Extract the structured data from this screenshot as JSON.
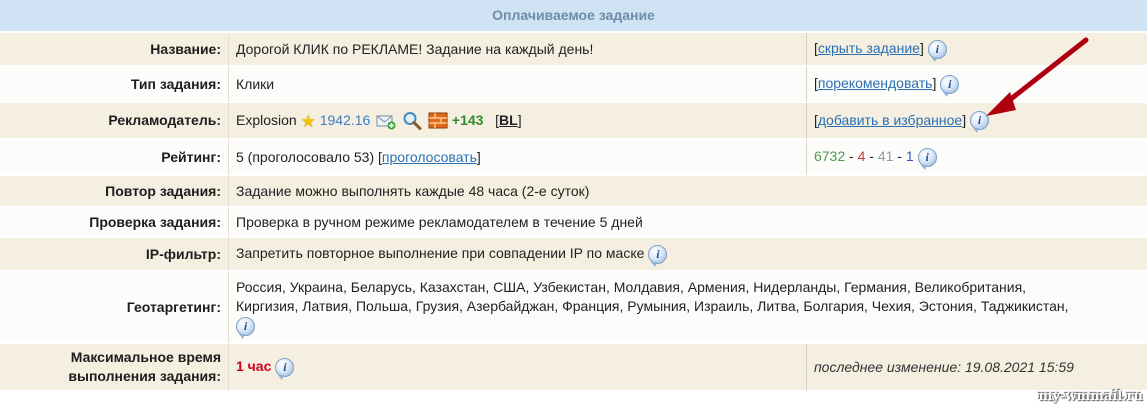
{
  "header": {
    "title": "Оплачиваемое задание"
  },
  "rows": {
    "name": {
      "label": "Название:",
      "value": "Дорогой КЛИК по РЕКЛАМЕ! Задание на каждый день!",
      "action": "скрыть задание"
    },
    "type": {
      "label": "Тип задания:",
      "value": "Клики",
      "action": "порекомендовать"
    },
    "advertiser": {
      "label": "Рекламодатель:",
      "name": "Explosion",
      "rating": "1942.16",
      "score": "+143",
      "bl": "BL",
      "action": "добавить в избранное"
    },
    "rating": {
      "label": "Рейтинг:",
      "value": "5 (проголосовало 53)",
      "vote_link": "проголосовать",
      "votes": {
        "green": "6732",
        "red": "4",
        "gray": "41",
        "blue": "1"
      }
    },
    "repeat": {
      "label": "Повтор задания:",
      "value": "Задание можно выполнять каждые 48 часа (2-е суток)"
    },
    "check": {
      "label": "Проверка задания:",
      "value": "Проверка в ручном режиме рекламодателем в течение 5 дней"
    },
    "ipfilter": {
      "label": "IP-фильтр:",
      "value": "Запретить повторное выполнение при совпадении IP по маске"
    },
    "geo": {
      "label": "Геотаргетинг:",
      "line1": "Россия, Украина, Беларусь, Казахстан, США, Узбекистан, Молдавия, Армения, Нидерланды, Германия, Великобритания,",
      "line2": "Киргизия, Латвия, Польша, Грузия, Азербайджан, Франция, Румыния, Израиль, Литва, Болгария, Чехия, Эстония, Таджикистан,"
    },
    "maxtime": {
      "label1": "Максимальное время",
      "label2": "выполнения задания:",
      "value": "1 час",
      "modified": "последнее изменение: 19.08.2021 15:59"
    }
  },
  "watermark": "my-wmmail.ru",
  "colors": {
    "header_bg": "#cfe3f4",
    "row_beige": "#f4efe1",
    "link": "#2b6fb3",
    "arrow": "#b00010"
  }
}
